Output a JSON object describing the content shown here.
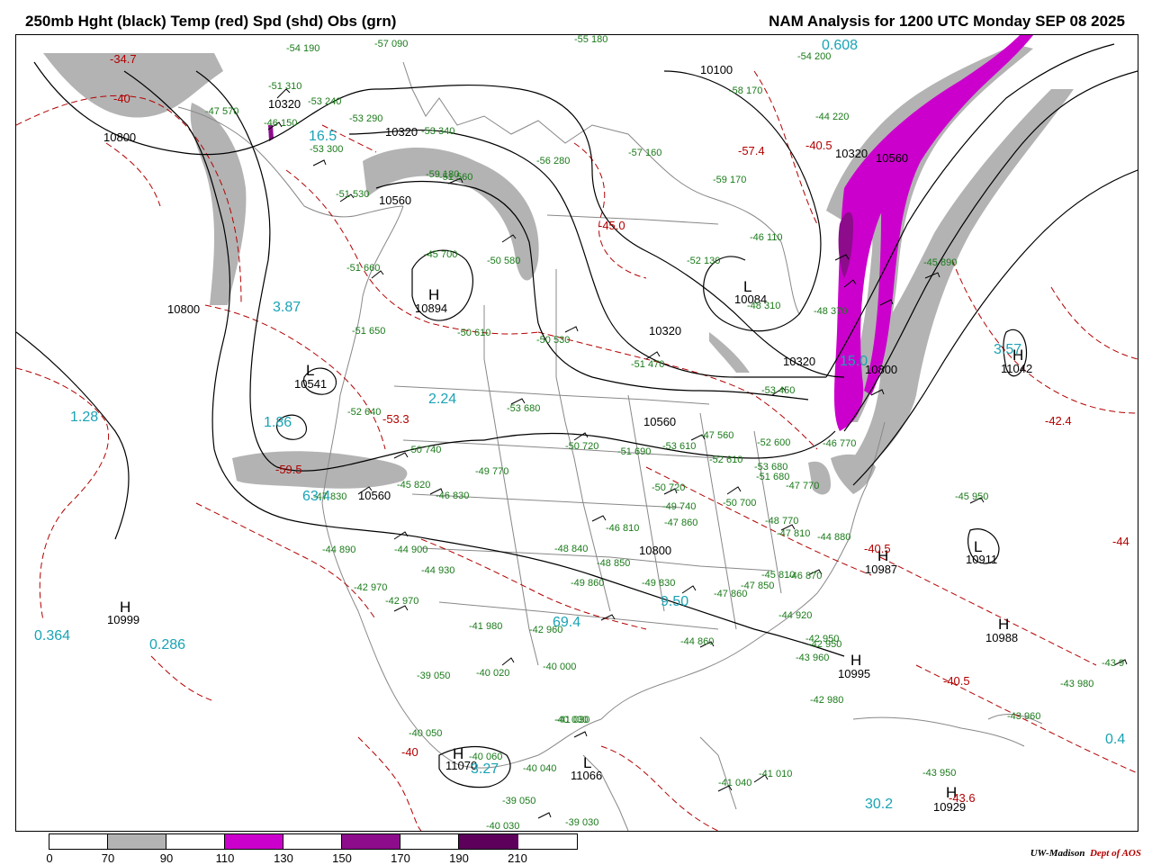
{
  "header": {
    "left": "250mb Hght (black) Temp (red) Spd (shd) Obs (grn)",
    "right": "NAM Analysis for 1200 UTC Monday  SEP 08 2025"
  },
  "legend": {
    "ticks": [
      "0",
      "70",
      "90",
      "110",
      "130",
      "150",
      "170",
      "190",
      "210"
    ],
    "fills": [
      "#ffffff",
      "#b3b3b3",
      "#ffffff",
      "#cc00cc",
      "#ffffff",
      "#8c0c8c",
      "#ffffff",
      "#5c005c"
    ]
  },
  "credit": {
    "org": "UW-Madison",
    "dept": "Dept of AOS"
  },
  "colors": {
    "height_contour": "#000000",
    "temperature_contour": "#b30000",
    "wind_shade_70_90": "#b3b3b3",
    "wind_shade_110_130": "#cc00cc",
    "wind_shade_150_170": "#8c0c8c",
    "obs": "#1a7a1a",
    "extrema_value": "#1aa3b5",
    "map_lines": "#888888"
  },
  "map": {
    "height_labels": [
      "10800",
      "10320",
      "10560",
      "10320",
      "10560",
      "10800",
      "10320",
      "10560",
      "10320",
      "10800",
      "10100",
      "10560",
      "10320",
      "10800"
    ],
    "pressure_centers": [
      {
        "type": "H",
        "value": "10894"
      },
      {
        "type": "L",
        "value": "10541"
      },
      {
        "type": "L",
        "value": "10084"
      },
      {
        "type": "L",
        "value": "10911"
      },
      {
        "type": "H",
        "value": "10987"
      },
      {
        "type": "H",
        "value": "10988"
      },
      {
        "type": "H",
        "value": "10995"
      },
      {
        "type": "H",
        "value": "10999"
      },
      {
        "type": "H",
        "value": "11042"
      },
      {
        "type": "H",
        "value": "10929"
      },
      {
        "type": "L",
        "value": "11066"
      },
      {
        "type": "H",
        "value": "11070"
      }
    ],
    "wind_extrema": [
      "3.87",
      "1.28",
      "1.86",
      "2.24",
      "63.4",
      "0.364",
      "0.286",
      "69.4",
      "9.50",
      "3.57",
      "30.2",
      "0.608",
      "0.4",
      "16.5",
      "3.27",
      "15.0"
    ],
    "temperature_extrema": [
      "-34.7",
      "-40",
      "-59.5",
      "-53.3",
      "-40.5",
      "-42.4",
      "-40.5",
      "-43.6",
      "-40.5",
      "-57.4",
      "-45.0",
      "-40",
      "-44"
    ],
    "station_obs": [
      "-54 190",
      "-57 090",
      "-51 310",
      "-47 570",
      "-53 240",
      "-53 290",
      "-55 180",
      "-59 180",
      "-53 300",
      "-53 340",
      "-51 530",
      "-51 560",
      "-56 280",
      "-57 160",
      "-59 170",
      "-58 170",
      "-54 200",
      "-44 220",
      "-46 150",
      "-45 700",
      "-50 580",
      "-51 660",
      "-51 650",
      "-52 640",
      "-50 610",
      "-50 530",
      "-51 470",
      "-53 680",
      "-52 130",
      "-46 110",
      "-45 890",
      "-53 450",
      "-47 560",
      "-48 310",
      "-48 370",
      "-50 740",
      "-49 770",
      "-45 820",
      "-46 830",
      "-47 830",
      "-44 890",
      "-44 900",
      "-44 930",
      "-42 970",
      "-42 970",
      "-41 980",
      "-42 960",
      "-39 050",
      "-40 020",
      "-40 000",
      "-40 050",
      "-40 030",
      "-40 060",
      "-40 040",
      "-39 050",
      "-50 720",
      "-51 690",
      "-53 610",
      "-52 610",
      "-50 720",
      "-49 740",
      "-50 700",
      "-51 680",
      "-52 600",
      "-47 770",
      "-46 770",
      "-48 770",
      "-47 810",
      "-44 880",
      "-46 870",
      "-47 850",
      "-47 860",
      "-44 920",
      "-42 950",
      "-44 860",
      "-43 960",
      "-42 980",
      "-45 950",
      "-43 980",
      "-43 960",
      "-43 950",
      "-41 040",
      "-41 010",
      "-39 030",
      "-42 950",
      "-40 030",
      "-41 030",
      "-45 810",
      "-48 840",
      "-49 860",
      "-47 860",
      "-46 810",
      "-48 850",
      "-49 830",
      "-53 680",
      "-43 9"
    ]
  }
}
